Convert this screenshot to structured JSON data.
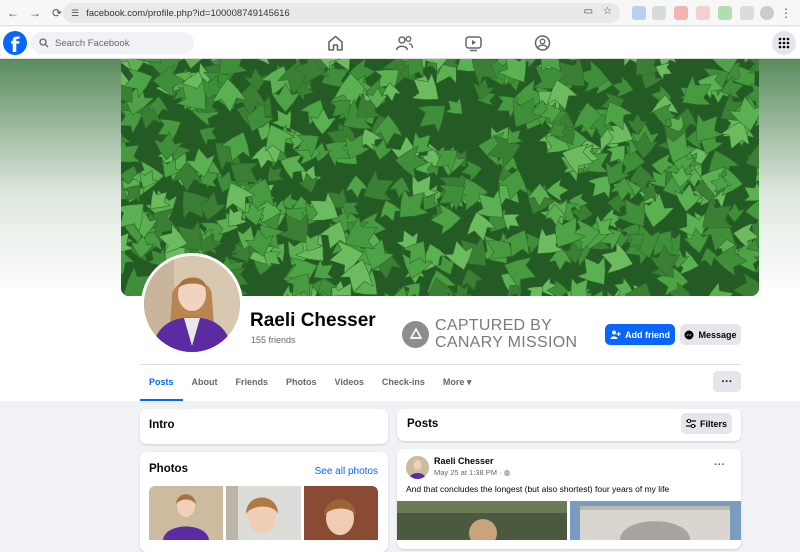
{
  "browser": {
    "url": "facebook.com/profile.php?id=100008749145616",
    "back_icon": "back-arrow",
    "forward_icon": "forward-arrow",
    "reload_icon": "reload"
  },
  "header": {
    "logo_letter": "f",
    "search_placeholder": "Search Facebook"
  },
  "profile": {
    "name": "Raeli Chesser",
    "friends": "155 friends",
    "add_friend_label": "Add friend",
    "message_label": "Message"
  },
  "watermark": {
    "line1": "CAPTURED BY",
    "line2": "CANARY MISSION"
  },
  "tabs": [
    {
      "label": "Posts",
      "active": true
    },
    {
      "label": "About"
    },
    {
      "label": "Friends"
    },
    {
      "label": "Photos"
    },
    {
      "label": "Videos"
    },
    {
      "label": "Check-ins"
    },
    {
      "label": "More ▾"
    }
  ],
  "intro": {
    "title": "Intro"
  },
  "photos": {
    "title": "Photos",
    "see_all": "See all photos"
  },
  "posts": {
    "title": "Posts",
    "filters_label": "Filters",
    "post": {
      "author": "Raeli Chesser",
      "date": "May 25 at 1:38 PM · ",
      "text": "And that concludes the longest (but also shortest) four years of my life"
    }
  },
  "colors": {
    "brand": "#0866ff",
    "page_bg": "#f0f2f5",
    "button_gray": "#e4e6eb"
  }
}
